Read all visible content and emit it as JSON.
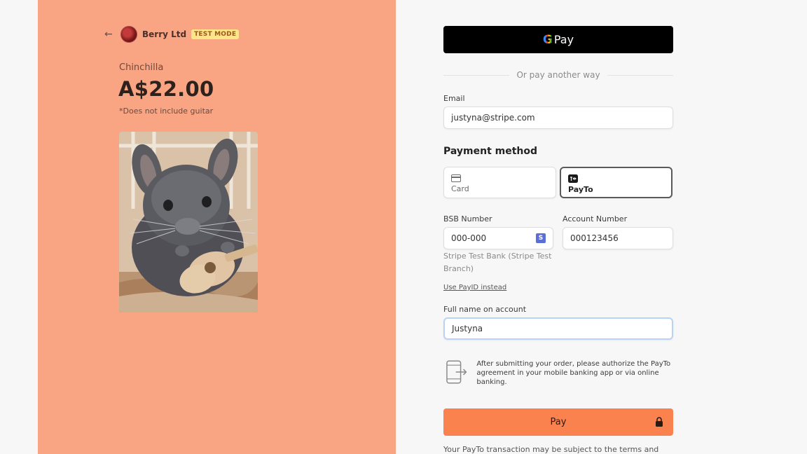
{
  "merchant": {
    "name": "Berry Ltd",
    "badge": "TEST MODE"
  },
  "product": {
    "name": "Chinchilla",
    "price": "A$22.00",
    "note": "*Does not include guitar"
  },
  "wallet": {
    "g": "G",
    "label": "Pay"
  },
  "divider": {
    "text": "Or pay another way"
  },
  "email": {
    "label": "Email",
    "value": "justyna@stripe.com"
  },
  "payment_method": {
    "title": "Payment method",
    "tabs": [
      {
        "label": "Card",
        "icon": "card-icon"
      },
      {
        "label": "PayTo",
        "icon": "payto-icon",
        "selected": true
      }
    ]
  },
  "bank": {
    "bsb_label": "BSB Number",
    "bsb_value": "000-000",
    "bsb_badge": "S",
    "account_label": "Account Number",
    "account_value": "000123456",
    "bank_name": "Stripe Test Bank (Stripe Test Branch)",
    "payid_link": "Use PayID instead",
    "fullname_label": "Full name on account",
    "fullname_value": "Justyna"
  },
  "info": {
    "text": "After submitting your order, please authorize the PayTo agreement in your mobile banking app or via online banking."
  },
  "pay_button": {
    "label": "Pay"
  },
  "footer": {
    "text": "Your PayTo transaction may be subject to the terms and"
  },
  "colors": {
    "left_bg": "#f9a584",
    "pay_button": "#f9824f",
    "badge_bg": "#fde68a",
    "page_bg": "#f7f7f7"
  }
}
